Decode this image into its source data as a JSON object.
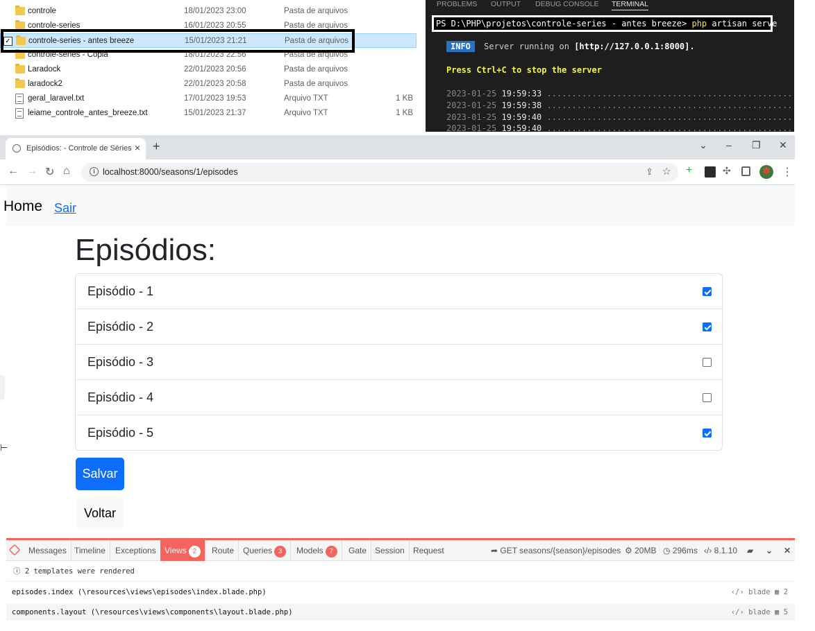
{
  "explorer": {
    "rows": [
      {
        "name": "controle",
        "date": "18/01/2023 23:00",
        "type": "Pasta de arquivos",
        "size": "",
        "kind": "folder"
      },
      {
        "name": "controle-series",
        "date": "16/01/2023 20:55",
        "type": "Pasta de arquivos",
        "size": "",
        "kind": "folder"
      },
      {
        "name": "controle-series - antes breeze",
        "date": "15/01/2023 21:21",
        "type": "Pasta de arquivos",
        "size": "",
        "kind": "folder",
        "selected": true
      },
      {
        "name": "controle-series - Cópia",
        "date": "18/01/2023 22:56",
        "type": "Pasta de arquivos",
        "size": "",
        "kind": "folder"
      },
      {
        "name": "Laradock",
        "date": "22/01/2023 20:56",
        "type": "Pasta de arquivos",
        "size": "",
        "kind": "folder"
      },
      {
        "name": "laradock2",
        "date": "22/01/2023 20:58",
        "type": "Pasta de arquivos",
        "size": "",
        "kind": "folder"
      },
      {
        "name": "geral_laravel.txt",
        "date": "17/01/2023 19:53",
        "type": "Arquivo TXT",
        "size": "1 KB",
        "kind": "txt"
      },
      {
        "name": "leiame_controle_antes_breeze.txt",
        "date": "15/01/2023 21:37",
        "type": "Arquivo TXT",
        "size": "1 KB",
        "kind": "txt"
      }
    ]
  },
  "terminal": {
    "tabs": [
      "PROBLEMS",
      "OUTPUT",
      "DEBUG CONSOLE",
      "TERMINAL"
    ],
    "active_tab": "TERMINAL",
    "prompt": "PS D:\\PHP\\projetos\\controle-series - antes breeze>",
    "command": "php",
    "command_args": "artisan serve",
    "info_badge": "INFO",
    "info_text": "Server running on",
    "info_url": "[http://127.0.0.1:8000].",
    "ctrlc": "Press Ctrl+C to stop the server",
    "log": [
      {
        "date": "2023-01-25",
        "time": "19:59:33",
        "dots": "......................................................"
      },
      {
        "date": "2023-01-25",
        "time": "19:59:38",
        "dots": "......................................................"
      },
      {
        "date": "2023-01-25",
        "time": "19:59:40",
        "dots": "......................................................"
      },
      {
        "date": "2023-01-25",
        "time": "19:59:40",
        "dots": "......................................................"
      }
    ]
  },
  "browser": {
    "tab_title": "Episódios: - Controle de Séries",
    "tab_close": "×",
    "new_tab": "+",
    "url": "localhost:8000/seasons/1/episodes",
    "window_buttons": [
      "⌄",
      "–",
      "❐",
      "✕"
    ]
  },
  "page": {
    "nav_home": "Home",
    "nav_sair": "Sair",
    "title": "Episódios:",
    "episodes": [
      {
        "label": "Episódio - 1",
        "checked": true
      },
      {
        "label": "Episódio - 2",
        "checked": true
      },
      {
        "label": "Episódio - 3",
        "checked": false
      },
      {
        "label": "Episódio - 4",
        "checked": false
      },
      {
        "label": "Episódio - 5",
        "checked": true
      }
    ],
    "save_label": "Salvar",
    "back_label": "Voltar"
  },
  "debugbar": {
    "tabs": [
      {
        "label": "Messages",
        "badge": ""
      },
      {
        "label": "Timeline",
        "badge": ""
      },
      {
        "label": "Exceptions",
        "badge": ""
      },
      {
        "label": "Views",
        "badge": "2",
        "active": true
      },
      {
        "label": "Route",
        "badge": ""
      },
      {
        "label": "Queries",
        "badge": "3"
      },
      {
        "label": "Models",
        "badge": "7"
      },
      {
        "label": "Gate",
        "badge": ""
      },
      {
        "label": "Session",
        "badge": ""
      },
      {
        "label": "Request",
        "badge": ""
      }
    ],
    "route": "GET seasons/{season}/episodes",
    "memory": "20MB",
    "time": "296ms",
    "php_version": "8.1.10",
    "summary": "2 templates were rendered",
    "views": [
      {
        "name": "episodes.index (\\resources\\views\\episodes\\index.blade.php)",
        "engine": "blade",
        "count": "2"
      },
      {
        "name": "components.layout (\\resources\\views\\components\\layout.blade.php)",
        "engine": "blade",
        "count": "5"
      }
    ]
  },
  "colors": {
    "primary": "#0d6efd",
    "debugbar_accent": "#f4645f",
    "terminal_bg": "#1e1e1e",
    "selection": "#cce8ff"
  }
}
